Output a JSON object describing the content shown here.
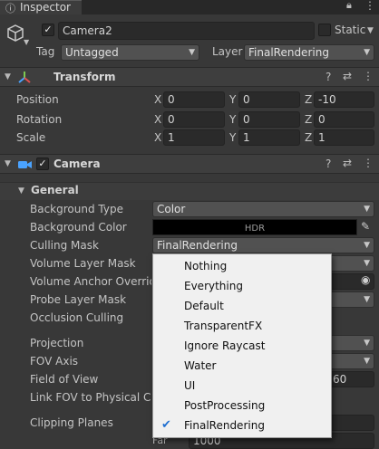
{
  "window": {
    "tab_label": "Inspector",
    "lock_icon": "lock-icon",
    "menu_icon": "kebab-menu-icon"
  },
  "gameobject": {
    "name": "Camera2",
    "static_label": "Static",
    "tag_label": "Tag",
    "tag_value": "Untagged",
    "layer_label": "Layer",
    "layer_value": "FinalRendering"
  },
  "transform": {
    "title": "Transform",
    "position_label": "Position",
    "rotation_label": "Rotation",
    "scale_label": "Scale",
    "axis_x": "X",
    "axis_y": "Y",
    "axis_z": "Z",
    "position": {
      "x": "0",
      "y": "0",
      "z": "-10"
    },
    "rotation": {
      "x": "0",
      "y": "0",
      "z": "0"
    },
    "scale": {
      "x": "1",
      "y": "1",
      "z": "1"
    }
  },
  "camera": {
    "title": "Camera",
    "general_label": "General",
    "background_type_label": "Background Type",
    "background_type_value": "Color",
    "background_color_label": "Background Color",
    "background_color_hdr": "HDR",
    "culling_mask_label": "Culling Mask",
    "culling_mask_value": "FinalRendering",
    "volume_layer_mask_label": "Volume Layer Mask",
    "volume_anchor_label": "Volume Anchor Override",
    "probe_layer_mask_label": "Probe Layer Mask",
    "occlusion_culling_label": "Occlusion Culling",
    "projection_label": "Projection",
    "fov_axis_label": "FOV Axis",
    "field_of_view_label": "Field of View",
    "field_of_view_value": "60",
    "link_fov_label": "Link FOV to Physical Camera",
    "clipping_planes_label": "Clipping Planes",
    "far_label": "Far",
    "far_value": "1000"
  },
  "culling_menu": {
    "items": [
      {
        "label": "Nothing",
        "checked": false
      },
      {
        "label": "Everything",
        "checked": false
      },
      {
        "label": "Default",
        "checked": false
      },
      {
        "label": "TransparentFX",
        "checked": false
      },
      {
        "label": "Ignore Raycast",
        "checked": false
      },
      {
        "label": "Water",
        "checked": false
      },
      {
        "label": "UI",
        "checked": false
      },
      {
        "label": "PostProcessing",
        "checked": false
      },
      {
        "label": "FinalRendering",
        "checked": true
      }
    ],
    "check_glyph": "✔"
  },
  "colors": {
    "panel_bg": "#383838",
    "field_bg": "#2a2a2a",
    "menu_bg": "#f0f0f0",
    "accent": "#1f6fd1",
    "camera_icon": "#4aa3ff"
  }
}
